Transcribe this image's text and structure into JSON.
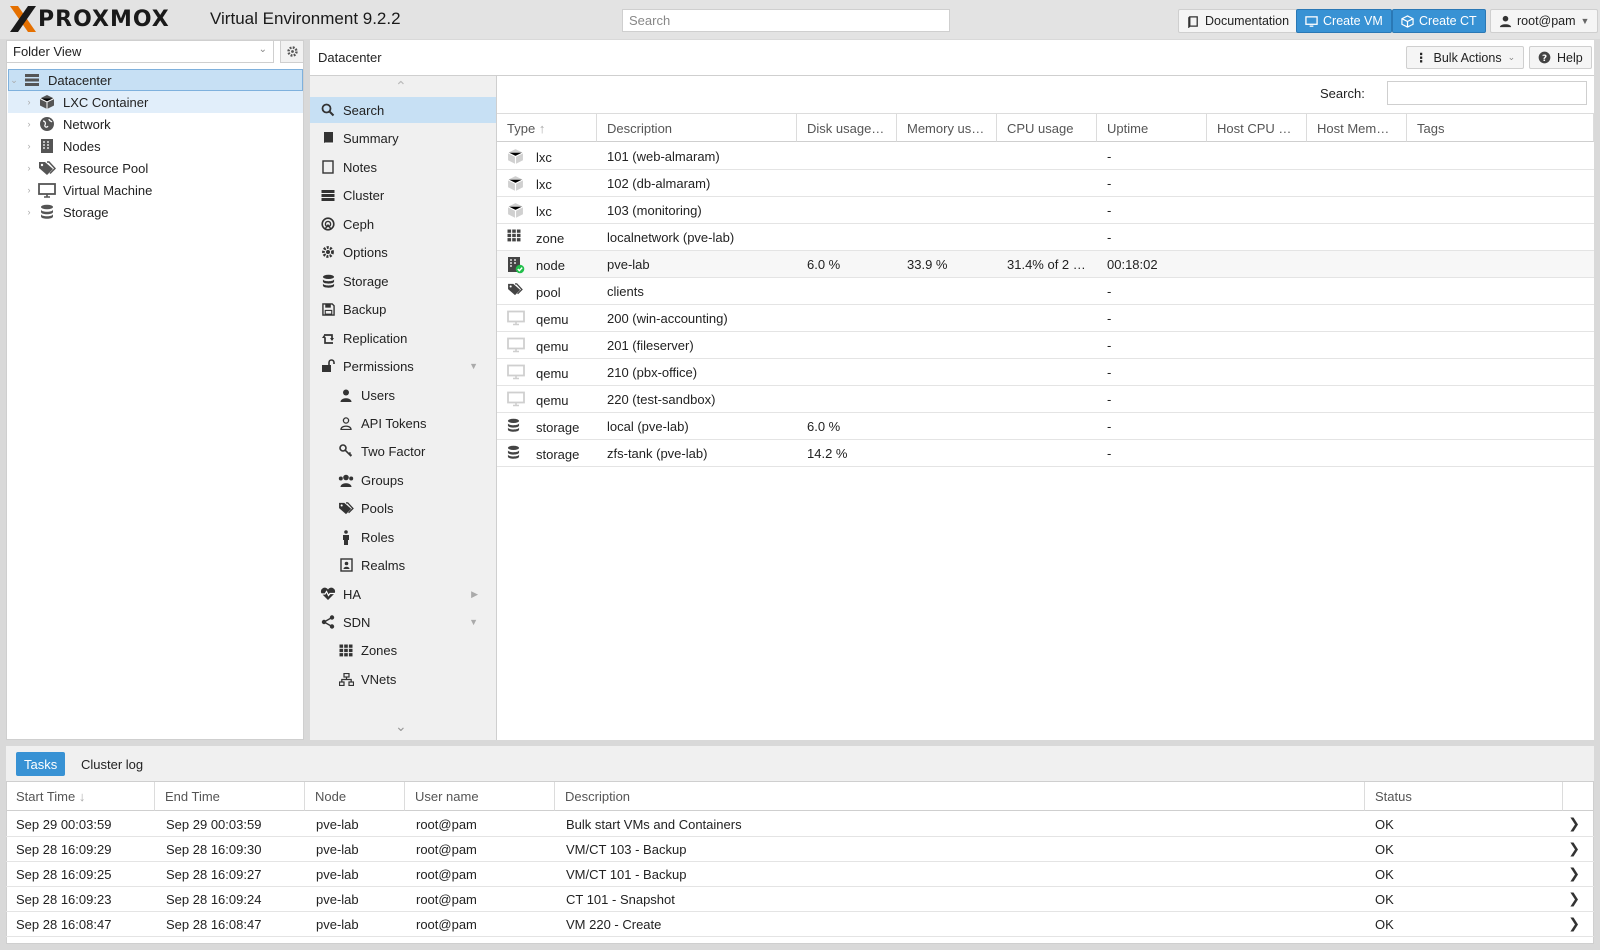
{
  "header": {
    "brand": "PROXMOX",
    "app_title": "Virtual Environment 9.2.2",
    "search_placeholder": "Search",
    "documentation": "Documentation",
    "create_vm": "Create VM",
    "create_ct": "Create CT",
    "user": "root@pam"
  },
  "left": {
    "view": "Folder View",
    "tree": [
      {
        "label": "Datacenter",
        "icon": "datacenter-icon"
      },
      {
        "label": "LXC Container",
        "icon": "container-icon"
      },
      {
        "label": "Network",
        "icon": "network-globe-icon"
      },
      {
        "label": "Nodes",
        "icon": "nodes-icon"
      },
      {
        "label": "Resource Pool",
        "icon": "tags-icon"
      },
      {
        "label": "Virtual Machine",
        "icon": "monitor-icon"
      },
      {
        "label": "Storage",
        "icon": "database-icon"
      }
    ]
  },
  "content": {
    "title": "Datacenter",
    "bulk_actions": "Bulk Actions",
    "help": "Help",
    "search_label": "Search:"
  },
  "nav": [
    {
      "label": "Search",
      "icon": "search-icon"
    },
    {
      "label": "Summary",
      "icon": "book-icon"
    },
    {
      "label": "Notes",
      "icon": "note-icon"
    },
    {
      "label": "Cluster",
      "icon": "server-icon"
    },
    {
      "label": "Ceph",
      "icon": "ceph-icon"
    },
    {
      "label": "Options",
      "icon": "gear-icon"
    },
    {
      "label": "Storage",
      "icon": "database-icon"
    },
    {
      "label": "Backup",
      "icon": "floppy-icon"
    },
    {
      "label": "Replication",
      "icon": "retweet-icon"
    },
    {
      "label": "Permissions",
      "icon": "unlock-icon"
    },
    {
      "label": "Users",
      "icon": "user-icon"
    },
    {
      "label": "API Tokens",
      "icon": "user-outline-icon"
    },
    {
      "label": "Two Factor",
      "icon": "key-icon"
    },
    {
      "label": "Groups",
      "icon": "users-icon"
    },
    {
      "label": "Pools",
      "icon": "tags-icon"
    },
    {
      "label": "Roles",
      "icon": "male-icon"
    },
    {
      "label": "Realms",
      "icon": "address-book-icon"
    },
    {
      "label": "HA",
      "icon": "heartbeat-icon"
    },
    {
      "label": "SDN",
      "icon": "sdn-icon"
    },
    {
      "label": "Zones",
      "icon": "grid-icon"
    },
    {
      "label": "VNets",
      "icon": "sitemap-icon"
    }
  ],
  "grid": {
    "columns": [
      "Type",
      "Description",
      "Disk usage…",
      "Memory us…",
      "CPU usage",
      "Uptime",
      "Host CPU …",
      "Host Mem…",
      "Tags"
    ],
    "rows": [
      {
        "type": "lxc",
        "icon": "container-icon",
        "description": "101 (web-almaram)",
        "disk": "",
        "memory": "",
        "cpu": "",
        "uptime": "-"
      },
      {
        "type": "lxc",
        "icon": "container-icon",
        "description": "102 (db-almaram)",
        "disk": "",
        "memory": "",
        "cpu": "",
        "uptime": "-"
      },
      {
        "type": "lxc",
        "icon": "container-icon",
        "description": "103 (monitoring)",
        "disk": "",
        "memory": "",
        "cpu": "",
        "uptime": "-"
      },
      {
        "type": "zone",
        "icon": "grid-icon",
        "description": "localnetwork (pve-lab)",
        "disk": "",
        "memory": "",
        "cpu": "",
        "uptime": "-"
      },
      {
        "type": "node",
        "icon": "node-online-icon",
        "description": "pve-lab",
        "disk": "6.0 %",
        "memory": "33.9 %",
        "cpu": "31.4% of 2 …",
        "uptime": "00:18:02"
      },
      {
        "type": "pool",
        "icon": "tags-icon",
        "description": "clients",
        "disk": "",
        "memory": "",
        "cpu": "",
        "uptime": "-"
      },
      {
        "type": "qemu",
        "icon": "monitor-icon",
        "description": "200 (win-accounting)",
        "disk": "",
        "memory": "",
        "cpu": "",
        "uptime": "-"
      },
      {
        "type": "qemu",
        "icon": "monitor-icon",
        "description": "201 (fileserver)",
        "disk": "",
        "memory": "",
        "cpu": "",
        "uptime": "-"
      },
      {
        "type": "qemu",
        "icon": "monitor-icon",
        "description": "210 (pbx-office)",
        "disk": "",
        "memory": "",
        "cpu": "",
        "uptime": "-"
      },
      {
        "type": "qemu",
        "icon": "monitor-icon",
        "description": "220 (test-sandbox)",
        "disk": "",
        "memory": "",
        "cpu": "",
        "uptime": "-"
      },
      {
        "type": "storage",
        "icon": "database-icon",
        "description": "local (pve-lab)",
        "disk": "6.0 %",
        "memory": "",
        "cpu": "",
        "uptime": "-"
      },
      {
        "type": "storage",
        "icon": "database-icon",
        "description": "zfs-tank (pve-lab)",
        "disk": "14.2 %",
        "memory": "",
        "cpu": "",
        "uptime": "-"
      }
    ]
  },
  "bottom": {
    "tabs": [
      "Tasks",
      "Cluster log"
    ],
    "columns": [
      "Start Time",
      "End Time",
      "Node",
      "User name",
      "Description",
      "Status"
    ],
    "rows": [
      {
        "start": "Sep 29 00:03:59",
        "end": "Sep 29 00:03:59",
        "node": "pve-lab",
        "user": "root@pam",
        "description": "Bulk start VMs and Containers",
        "status": "OK"
      },
      {
        "start": "Sep 28 16:09:29",
        "end": "Sep 28 16:09:30",
        "node": "pve-lab",
        "user": "root@pam",
        "description": "VM/CT 103 - Backup",
        "status": "OK"
      },
      {
        "start": "Sep 28 16:09:25",
        "end": "Sep 28 16:09:27",
        "node": "pve-lab",
        "user": "root@pam",
        "description": "VM/CT 101 - Backup",
        "status": "OK"
      },
      {
        "start": "Sep 28 16:09:23",
        "end": "Sep 28 16:09:24",
        "node": "pve-lab",
        "user": "root@pam",
        "description": "CT 101 - Snapshot",
        "status": "OK"
      },
      {
        "start": "Sep 28 16:08:47",
        "end": "Sep 28 16:08:47",
        "node": "pve-lab",
        "user": "root@pam",
        "description": "VM 220 - Create",
        "status": "OK"
      }
    ]
  },
  "colors": {
    "accent": "#3892d4",
    "selection": "#c7e0f4",
    "brand_orange": "#e57000"
  }
}
